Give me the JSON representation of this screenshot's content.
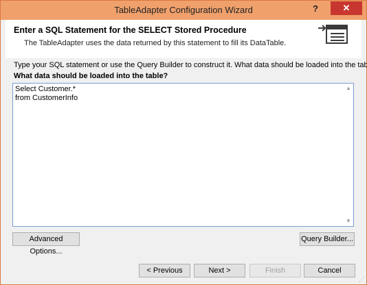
{
  "window": {
    "title": "TableAdapter Configuration Wizard",
    "help_glyph": "?",
    "close_glyph": "✕"
  },
  "header": {
    "title": "Enter a SQL Statement for the SELECT Stored Procedure",
    "subtitle": "The TableAdapter uses the data returned by this statement to fill its DataTable."
  },
  "instructions": {
    "line1": "Type your SQL statement or use the Query Builder to construct it. What data should be loaded into the table?",
    "line2": "What data should be loaded into the table?"
  },
  "sql_editor": {
    "value": "Select Customer.*\nfrom CustomerInfo"
  },
  "buttons": {
    "advanced_options": "Advanced Options...",
    "query_builder": "Query Builder...",
    "previous": "< Previous",
    "next": "Next >",
    "finish": "Finish",
    "cancel": "Cancel"
  },
  "colors": {
    "titlebar": "#f0a06b",
    "close_button": "#c7372f",
    "editor_border": "#7a9bd1"
  }
}
